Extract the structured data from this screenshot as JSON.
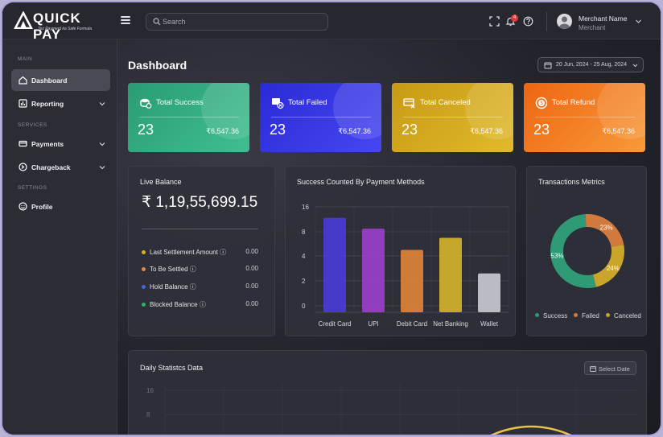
{
  "app": {
    "logo_text": "QUICK PAY",
    "logo_tagline": "Tez Payment ka Safe Formula"
  },
  "topbar": {
    "search_placeholder": "Search",
    "notification_count": "4",
    "user_name": "Merchant Name",
    "user_role": "Merchant"
  },
  "sidebar": {
    "sections": {
      "main": "MAIN",
      "services": "SERVICES",
      "settings": "SETTINGS"
    },
    "items": [
      {
        "label": "Dashboard",
        "icon": "home-icon",
        "active": true
      },
      {
        "label": "Reporting",
        "icon": "report-icon"
      },
      {
        "label": "Payments",
        "icon": "payments-icon"
      },
      {
        "label": "Chargeback",
        "icon": "chargeback-icon"
      },
      {
        "label": "Profile",
        "icon": "smile-icon"
      }
    ]
  },
  "main": {
    "title": "Dashboard",
    "date_range": "20 Jun, 2024 - 25 Aug, 2024"
  },
  "cards": [
    {
      "title": "Total Success",
      "count": "23",
      "amount": "₹6,547.36",
      "color": "#2fa57a",
      "icon": "coins-icon"
    },
    {
      "title": "Total Failed",
      "count": "23",
      "amount": "₹6,547.36",
      "color": "#2f2fe0",
      "icon": "failed-icon"
    },
    {
      "title": "Total Canceled",
      "count": "23",
      "amount": "₹6,547.36",
      "color": "#d0a41c",
      "icon": "cancel-icon"
    },
    {
      "title": "Total Refund",
      "count": "23",
      "amount": "₹6,547.36",
      "color": "#f2711a",
      "icon": "refund-icon"
    }
  ],
  "live_balance": {
    "title": "Live Balance",
    "amount": "₹ 1,19,55,699.15",
    "rows": [
      {
        "label": "Last Settlement Amount ⓘ",
        "value": "0.00",
        "color": "#d4b12a"
      },
      {
        "label": "To Be Settled ⓘ",
        "value": "0.00",
        "color": "#e08a4a"
      },
      {
        "label": "Hold Balance ⓘ",
        "value": "0.00",
        "color": "#4a66d0"
      },
      {
        "label": "Blocked Balance ⓘ",
        "value": "0.00",
        "color": "#2fb06a"
      }
    ]
  },
  "chart_data": [
    {
      "type": "bar",
      "title": "Success Counted By Payment Methods",
      "categories": [
        "Credit Card",
        "UPI",
        "Debit Card",
        "Net Banking",
        "Wallet"
      ],
      "values": [
        12.5,
        9,
        5,
        7,
        2.6
      ],
      "colors": [
        "#4a3bd6",
        "#9a3fc8",
        "#e0823a",
        "#d4b12a",
        "#c8c8d0"
      ],
      "ylim": [
        0,
        16
      ],
      "yticks": [
        "16",
        "8",
        "4",
        "2",
        "0"
      ],
      "grid": true
    },
    {
      "type": "pie",
      "title": "Transactions Metrics",
      "categories": [
        "Success",
        "Failed",
        "Canceled"
      ],
      "values": [
        53,
        23,
        24
      ],
      "labels": [
        "53%",
        "23%",
        "24%"
      ],
      "colors": [
        "#2e9a76",
        "#d27a3d",
        "#c9a52c"
      ],
      "legend": "bottom"
    }
  ],
  "daily": {
    "title": "Daily Statistcs Data",
    "select_label": "Select Date",
    "yticks": [
      "16",
      "8"
    ]
  }
}
